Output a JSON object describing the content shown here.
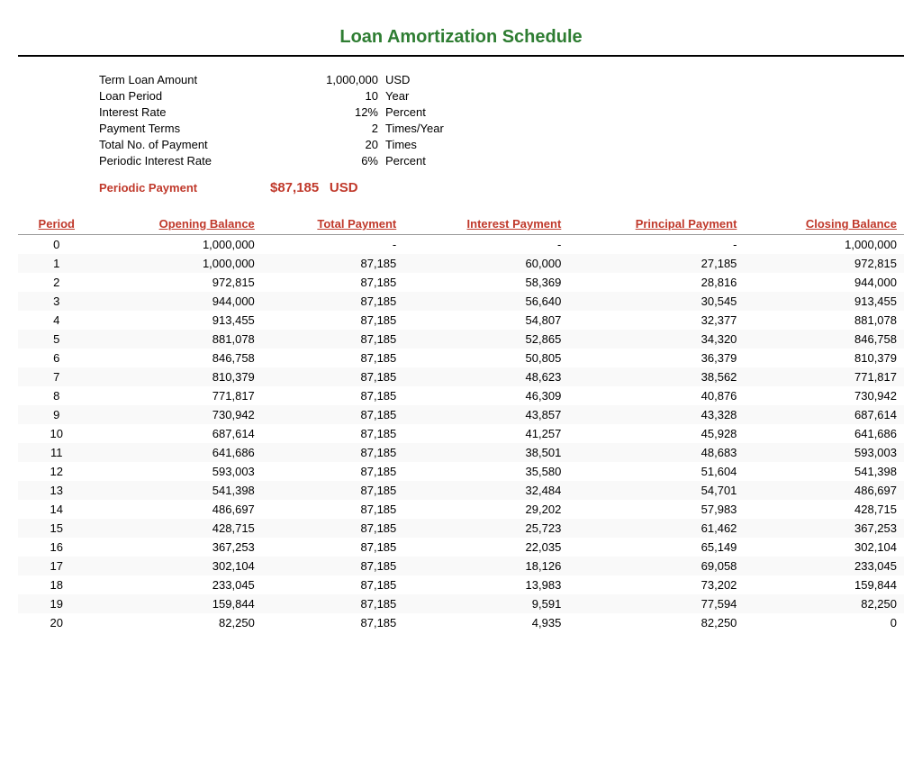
{
  "title": "Loan Amortization Schedule",
  "summary": {
    "fields": [
      {
        "label": "Term Loan Amount",
        "value": "1,000,000",
        "unit": "USD"
      },
      {
        "label": "Loan Period",
        "value": "10",
        "unit": "Year"
      },
      {
        "label": "Interest Rate",
        "value": "12%",
        "unit": "Percent"
      },
      {
        "label": "Payment Terms",
        "value": "2",
        "unit": "Times/Year"
      },
      {
        "label": "Total No. of Payment",
        "value": "20",
        "unit": "Times"
      },
      {
        "label": "Periodic Interest Rate",
        "value": "6%",
        "unit": "Percent"
      }
    ],
    "periodic_payment_label": "Periodic Payment",
    "periodic_payment_value": "$87,185",
    "periodic_payment_unit": "USD"
  },
  "table": {
    "headers": [
      "Period",
      "Opening Balance",
      "Total Payment",
      "Interest Payment",
      "Principal Payment",
      "Closing Balance"
    ],
    "rows": [
      [
        0,
        "1,000,000",
        "-",
        "-",
        "-",
        "1,000,000"
      ],
      [
        1,
        "1,000,000",
        "87,185",
        "60,000",
        "27,185",
        "972,815"
      ],
      [
        2,
        "972,815",
        "87,185",
        "58,369",
        "28,816",
        "944,000"
      ],
      [
        3,
        "944,000",
        "87,185",
        "56,640",
        "30,545",
        "913,455"
      ],
      [
        4,
        "913,455",
        "87,185",
        "54,807",
        "32,377",
        "881,078"
      ],
      [
        5,
        "881,078",
        "87,185",
        "52,865",
        "34,320",
        "846,758"
      ],
      [
        6,
        "846,758",
        "87,185",
        "50,805",
        "36,379",
        "810,379"
      ],
      [
        7,
        "810,379",
        "87,185",
        "48,623",
        "38,562",
        "771,817"
      ],
      [
        8,
        "771,817",
        "87,185",
        "46,309",
        "40,876",
        "730,942"
      ],
      [
        9,
        "730,942",
        "87,185",
        "43,857",
        "43,328",
        "687,614"
      ],
      [
        10,
        "687,614",
        "87,185",
        "41,257",
        "45,928",
        "641,686"
      ],
      [
        11,
        "641,686",
        "87,185",
        "38,501",
        "48,683",
        "593,003"
      ],
      [
        12,
        "593,003",
        "87,185",
        "35,580",
        "51,604",
        "541,398"
      ],
      [
        13,
        "541,398",
        "87,185",
        "32,484",
        "54,701",
        "486,697"
      ],
      [
        14,
        "486,697",
        "87,185",
        "29,202",
        "57,983",
        "428,715"
      ],
      [
        15,
        "428,715",
        "87,185",
        "25,723",
        "61,462",
        "367,253"
      ],
      [
        16,
        "367,253",
        "87,185",
        "22,035",
        "65,149",
        "302,104"
      ],
      [
        17,
        "302,104",
        "87,185",
        "18,126",
        "69,058",
        "233,045"
      ],
      [
        18,
        "233,045",
        "87,185",
        "13,983",
        "73,202",
        "159,844"
      ],
      [
        19,
        "159,844",
        "87,185",
        "9,591",
        "77,594",
        "82,250"
      ],
      [
        20,
        "82,250",
        "87,185",
        "4,935",
        "82,250",
        "0"
      ]
    ]
  }
}
